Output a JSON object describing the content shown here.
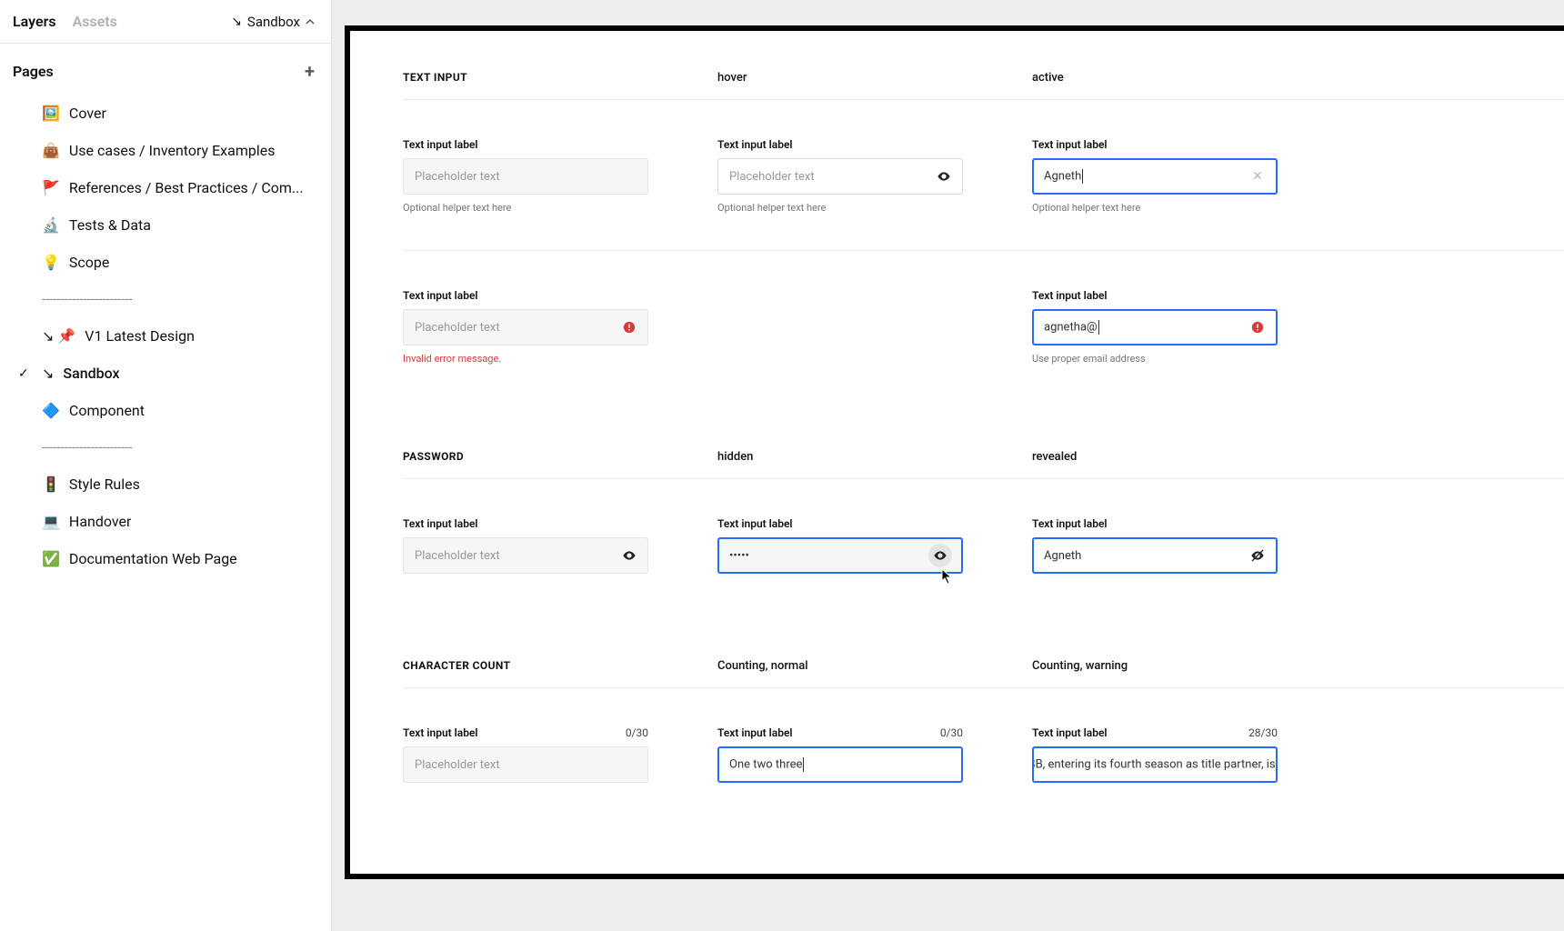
{
  "sidebar": {
    "tabs": {
      "layers": "Layers",
      "assets": "Assets"
    },
    "page_selector": "Sandbox",
    "pages_header": "Pages",
    "items": [
      {
        "emoji": "🖼️",
        "label": "Cover"
      },
      {
        "emoji": "👜",
        "label": "Use cases / Inventory Examples"
      },
      {
        "emoji": "🚩",
        "label": "References  / Best Practices / Com..."
      },
      {
        "emoji": "🔬",
        "label": "Tests & Data"
      },
      {
        "emoji": "💡",
        "label": "Scope"
      },
      {
        "emoji": "",
        "label": "------------------------",
        "divider": true
      },
      {
        "emoji": "↘ 📌",
        "label": "V1  Latest Design"
      },
      {
        "emoji": "↘",
        "label": "Sandbox",
        "selected": true
      },
      {
        "emoji": "🔷",
        "label": "Component"
      },
      {
        "emoji": "",
        "label": "------------------------",
        "divider": true
      },
      {
        "emoji": "🚦",
        "label": "Style Rules"
      },
      {
        "emoji": "💻",
        "label": "Handover"
      },
      {
        "emoji": "✅",
        "label": "Documentation Web Page"
      }
    ]
  },
  "canvas": {
    "section_text_input": {
      "title": "TEXT INPUT",
      "col2": "hover",
      "col3": "active",
      "row1": {
        "label": "Text input label",
        "placeholder": "Placeholder text",
        "helper": "Optional helper text here",
        "active_value": "Agneth"
      },
      "row2": {
        "label": "Text input label",
        "placeholder": "Placeholder text",
        "error_msg": "Invalid error message.",
        "active_value": "agnetha@",
        "active_helper": "Use proper email address"
      }
    },
    "section_password": {
      "title": "PASSWORD",
      "col2": "hidden",
      "col3": "revealed",
      "label": "Text input label",
      "placeholder": "Placeholder text",
      "hidden_value": "•••••",
      "revealed_value": "Agneth"
    },
    "section_char_count": {
      "title": "CHARACTER COUNT",
      "col2": "Counting, normal",
      "col3": "Counting, warning",
      "label": "Text input label",
      "placeholder": "Placeholder text",
      "c1_counter": "0/30",
      "c2_counter": "0/30",
      "c2_value": "One two three",
      "c3_counter": "28/30",
      "c3_value": "ABB, entering its fourth season as title partner, is conti"
    }
  }
}
